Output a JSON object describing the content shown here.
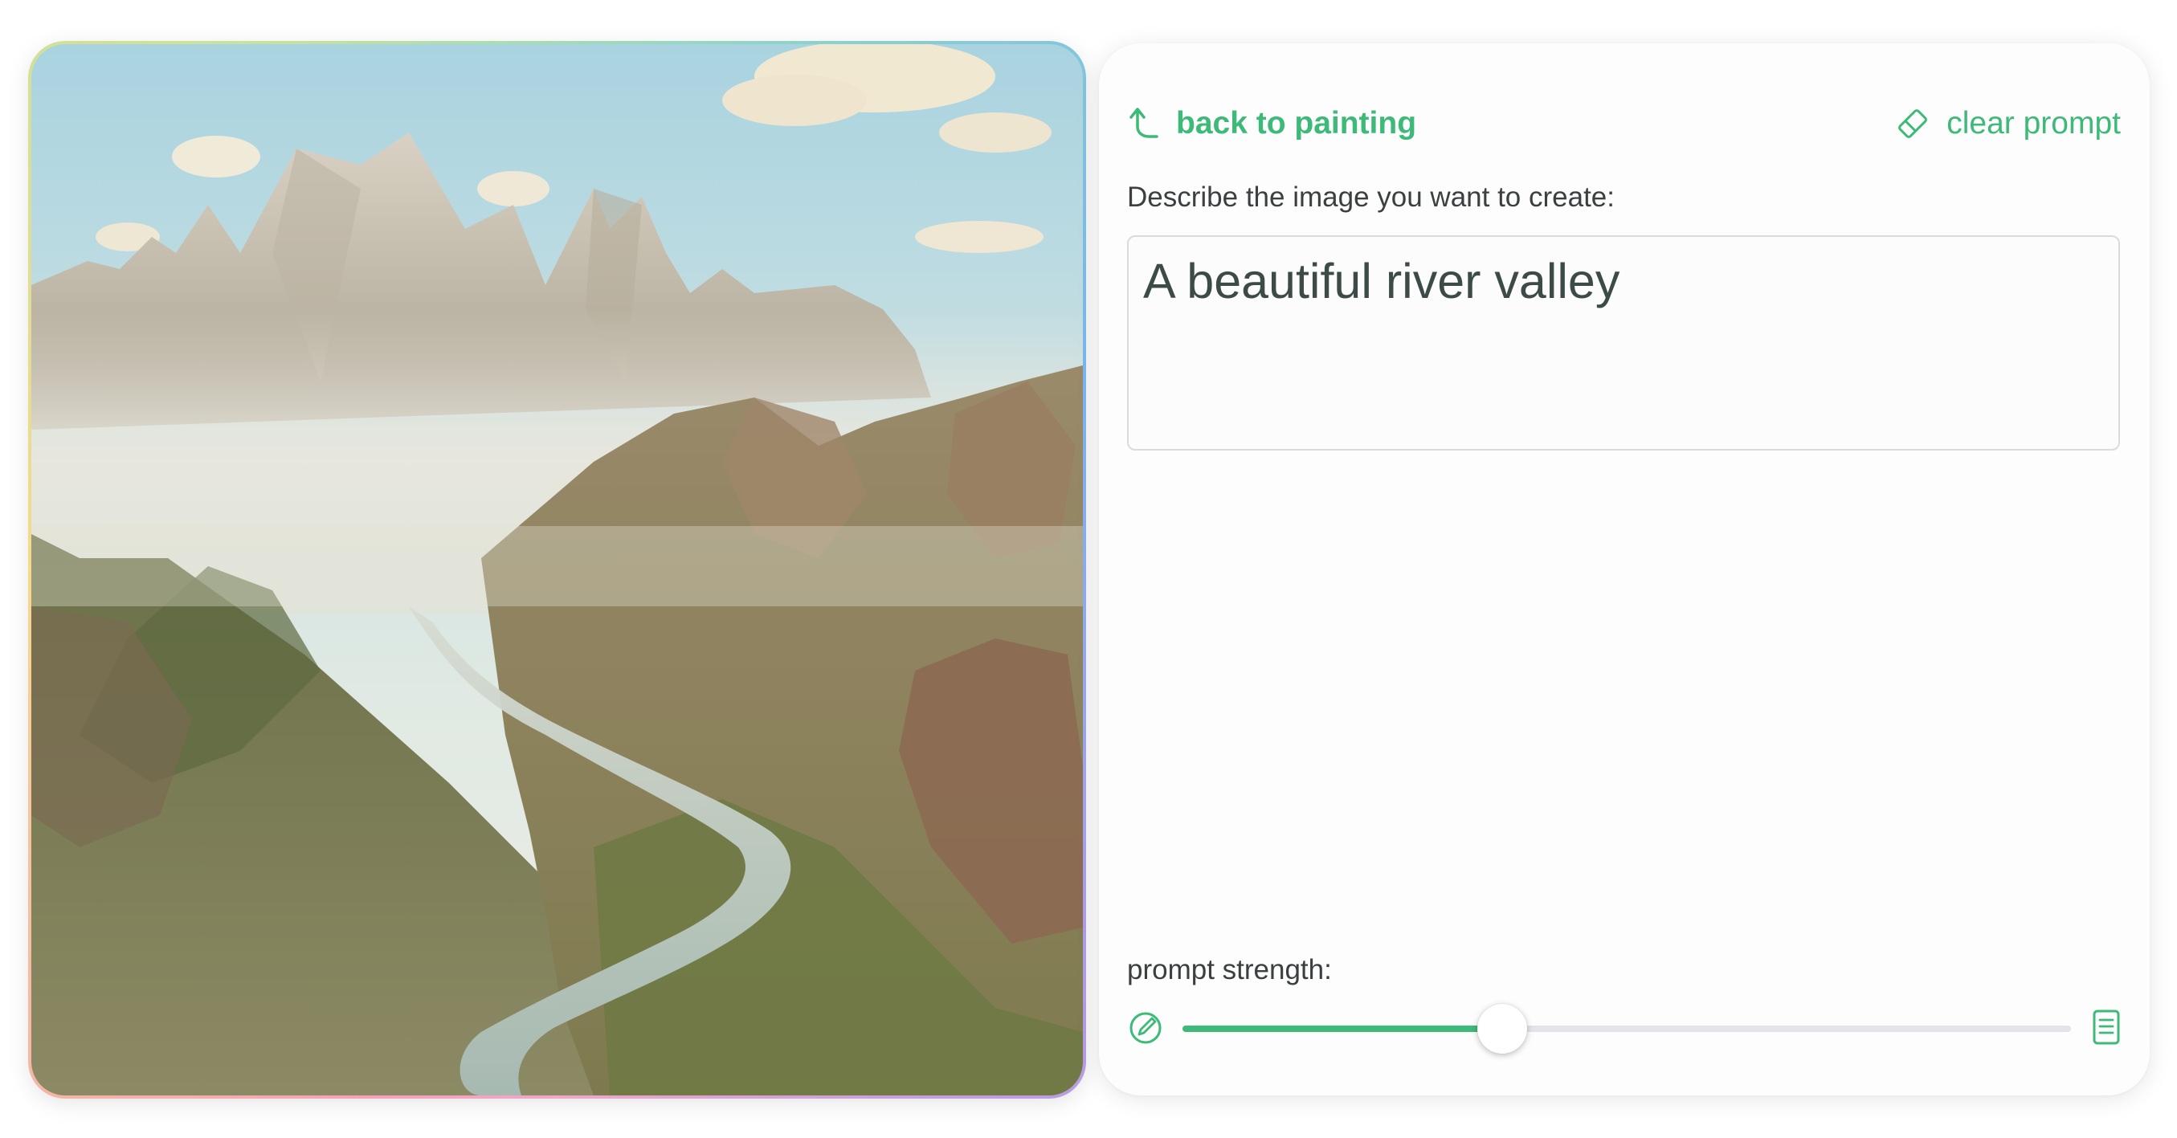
{
  "painting": {
    "icon": "landscape-painting"
  },
  "panel": {
    "back_label": "back to painting",
    "back_icon": "arrow-up-left-icon",
    "clear_label": "clear prompt",
    "clear_icon": "eraser-icon",
    "describe_label": "Describe the image you want to create:",
    "prompt_value": "A beautiful river valley",
    "strength_label": "prompt strength:",
    "strength_value": 0.36,
    "strength_min_icon": "pencil-circle-icon",
    "strength_max_icon": "document-icon"
  },
  "colors": {
    "accent": "#3dba78",
    "text": "#3b3f3f",
    "track": "#e3e4e8"
  }
}
